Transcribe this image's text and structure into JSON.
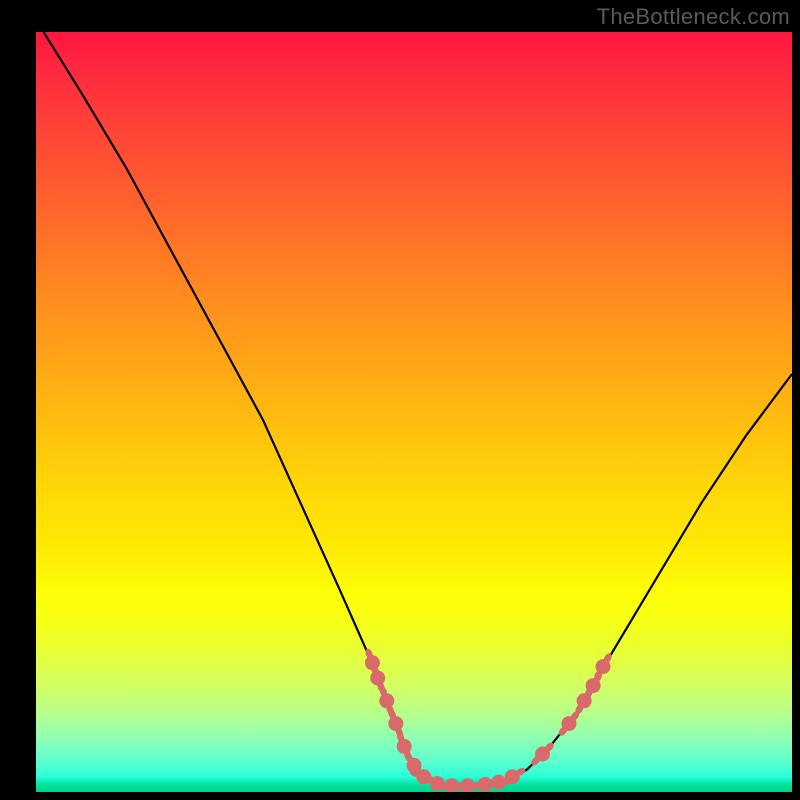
{
  "watermark": "TheBottleneck.com",
  "chart_data": {
    "type": "line",
    "title": "",
    "xlabel": "",
    "ylabel": "",
    "xlim": [
      0,
      100
    ],
    "ylim": [
      0,
      100
    ],
    "series": [
      {
        "name": "curve",
        "points": [
          {
            "x": 1,
            "y": 100
          },
          {
            "x": 6,
            "y": 92
          },
          {
            "x": 12,
            "y": 82
          },
          {
            "x": 18,
            "y": 71
          },
          {
            "x": 24,
            "y": 60
          },
          {
            "x": 30,
            "y": 49
          },
          {
            "x": 35,
            "y": 38
          },
          {
            "x": 40,
            "y": 27
          },
          {
            "x": 44,
            "y": 18
          },
          {
            "x": 47,
            "y": 10
          },
          {
            "x": 49,
            "y": 5
          },
          {
            "x": 51,
            "y": 2
          },
          {
            "x": 54,
            "y": 0.8
          },
          {
            "x": 58,
            "y": 0.7
          },
          {
            "x": 62,
            "y": 1.2
          },
          {
            "x": 65,
            "y": 3
          },
          {
            "x": 68,
            "y": 6
          },
          {
            "x": 72,
            "y": 11
          },
          {
            "x": 76,
            "y": 18
          },
          {
            "x": 82,
            "y": 28
          },
          {
            "x": 88,
            "y": 38
          },
          {
            "x": 94,
            "y": 47
          },
          {
            "x": 100,
            "y": 55
          }
        ]
      },
      {
        "name": "markers",
        "points": [
          {
            "x": 44.5,
            "y": 17
          },
          {
            "x": 45.2,
            "y": 15
          },
          {
            "x": 46.4,
            "y": 12
          },
          {
            "x": 47.6,
            "y": 9
          },
          {
            "x": 48.7,
            "y": 6
          },
          {
            "x": 50.0,
            "y": 3.5
          },
          {
            "x": 51.3,
            "y": 2.0
          },
          {
            "x": 53.1,
            "y": 1.1
          },
          {
            "x": 55.0,
            "y": 0.8
          },
          {
            "x": 57.1,
            "y": 0.8
          },
          {
            "x": 59.4,
            "y": 1.0
          },
          {
            "x": 61.2,
            "y": 1.3
          },
          {
            "x": 63.0,
            "y": 2.0
          },
          {
            "x": 67.0,
            "y": 5.0
          },
          {
            "x": 70.5,
            "y": 9.0
          },
          {
            "x": 72.5,
            "y": 12.0
          },
          {
            "x": 73.7,
            "y": 14.0
          },
          {
            "x": 75.0,
            "y": 16.5
          }
        ]
      }
    ],
    "colors": {
      "curve": "#000000",
      "marker": "#d96a6a"
    }
  }
}
